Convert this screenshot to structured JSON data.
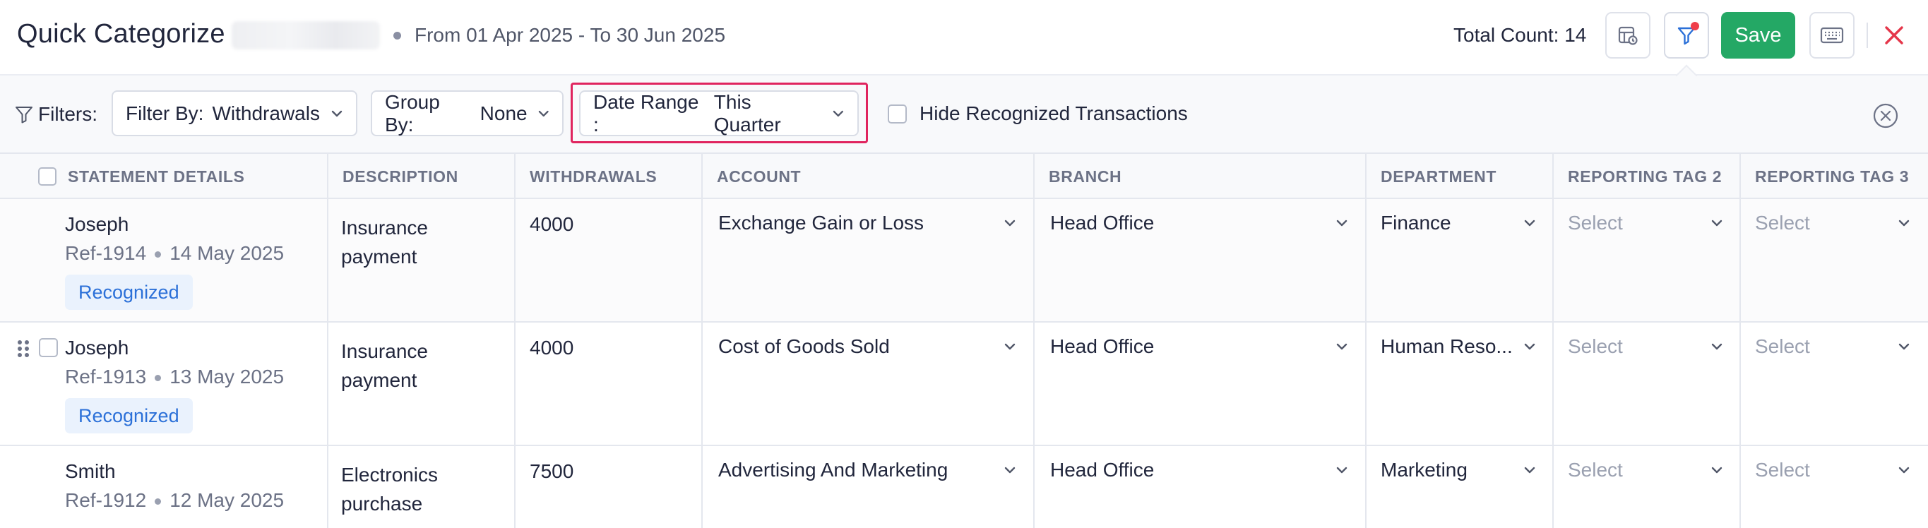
{
  "header": {
    "title": "Quick Categorize",
    "date_from_label": "From",
    "date_from": "01 Apr 2025",
    "date_to_label": "- To",
    "date_to": "30 Jun 2025",
    "total_count_label": "Total Count:",
    "total_count": "14",
    "save_label": "Save"
  },
  "filters": {
    "label": "Filters:",
    "filter_by_label": "Filter By:",
    "filter_by_value": "Withdrawals",
    "group_by_label": "Group By:",
    "group_by_value": "None",
    "date_range_label": "Date Range :",
    "date_range_value": "This Quarter",
    "hide_recognized_label": "Hide Recognized Transactions"
  },
  "table": {
    "columns": [
      "STATEMENT DETAILS",
      "DESCRIPTION",
      "WITHDRAWALS",
      "ACCOUNT",
      "BRANCH",
      "DEPARTMENT",
      "REPORTING TAG 2",
      "REPORTING TAG 3"
    ],
    "rows": [
      {
        "name": "Joseph",
        "ref": "Ref-1914",
        "date": "14 May 2025",
        "badge": "Recognized",
        "description_line1": "Insurance",
        "description_line2": "payment",
        "withdrawal": "4000",
        "account": "Exchange Gain or Loss",
        "branch": "Head Office",
        "department": "Finance",
        "tag2": "Select",
        "tag3": "Select"
      },
      {
        "name": "Joseph",
        "ref": "Ref-1913",
        "date": "13 May 2025",
        "badge": "Recognized",
        "description_line1": "Insurance",
        "description_line2": "payment",
        "withdrawal": "4000",
        "account": "Cost of Goods Sold",
        "branch": "Head Office",
        "department": "Human Reso...",
        "tag2": "Select",
        "tag3": "Select"
      },
      {
        "name": "Smith",
        "ref": "Ref-1912",
        "date": "12 May 2025",
        "badge": "",
        "description_line1": "Electronics",
        "description_line2": "purchase",
        "withdrawal": "7500",
        "account": "Advertising And Marketing",
        "branch": "Head Office",
        "department": "Marketing",
        "tag2": "Select",
        "tag3": "Select"
      }
    ]
  },
  "colors": {
    "accent_green": "#24a865",
    "badge_blue": "#2b70d8",
    "highlight_pink": "#e0245e",
    "close_red": "#e5364a"
  },
  "icons": [
    "filter-funnel-icon",
    "calendar-settings-icon",
    "filter-icon",
    "keyboard-icon",
    "close-icon",
    "chevron-down-icon",
    "clear-circle-icon",
    "drag-handle-icon"
  ]
}
